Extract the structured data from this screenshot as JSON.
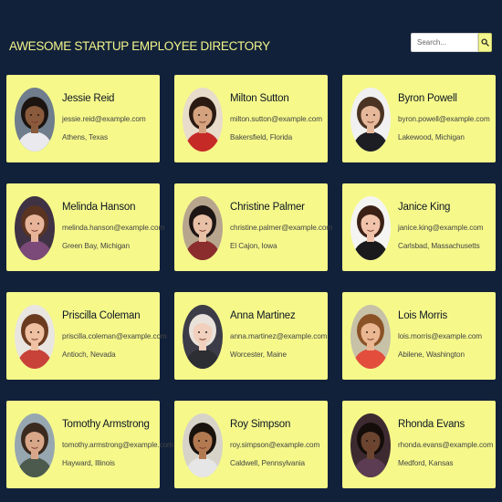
{
  "header": {
    "title": "AWESOME STARTUP EMPLOYEE DIRECTORY",
    "search_placeholder": "Search...",
    "search_icon": "search-icon"
  },
  "colors": {
    "background": "#12213a",
    "card": "#f6f98a",
    "title": "#f2f58a"
  },
  "employees": [
    {
      "name": "Jessie Reid",
      "email": "jessie.reid@example.com",
      "city": "Athens, Texas",
      "skin": "#8a5a3c",
      "hair": "#1b1410",
      "shirt": "#e9e9ee",
      "bg": "#6f7d8c"
    },
    {
      "name": "Milton Sutton",
      "email": "milton.sutton@example.com",
      "city": "Bakersfield, Florida",
      "skin": "#d4a27e",
      "hair": "#2a1a12",
      "shirt": "#c62a26",
      "bg": "#e8dccb"
    },
    {
      "name": "Byron Powell",
      "email": "byron.powell@example.com",
      "city": "Lakewood, Michigan",
      "skin": "#e6b89a",
      "hair": "#4a3322",
      "shirt": "#1d1d24",
      "bg": "#f1f1f1"
    },
    {
      "name": "Melinda Hanson",
      "email": "melinda.hanson@example.com",
      "city": "Green Bay, Michigan",
      "skin": "#e7b49a",
      "hair": "#5a3420",
      "shirt": "#7b4a78",
      "bg": "#3f3244"
    },
    {
      "name": "Christine Palmer",
      "email": "christine.palmer@example.com",
      "city": "El Cajon, Iowa",
      "skin": "#e8c0a6",
      "hair": "#1e1614",
      "shirt": "#8b2d2d",
      "bg": "#b8a58e"
    },
    {
      "name": "Janice King",
      "email": "janice.king@example.com",
      "city": "Carlsbad, Massachusetts",
      "skin": "#f0c3aa",
      "hair": "#3b2016",
      "shirt": "#1a1a1d",
      "bg": "#f4f4f2"
    },
    {
      "name": "Priscilla Coleman",
      "email": "priscilla.coleman@example.com",
      "city": "Antioch, Nevada",
      "skin": "#efc1a2",
      "hair": "#6b3b1f",
      "shirt": "#c8423a",
      "bg": "#e9e5e0"
    },
    {
      "name": "Anna Martinez",
      "email": "anna.martinez@example.com",
      "city": "Worcester, Maine",
      "skin": "#f1d0bd",
      "hair": "#e8e2da",
      "shirt": "#2d2d34",
      "bg": "#3c3c48"
    },
    {
      "name": "Lois Morris",
      "email": "lois.morris@example.com",
      "city": "Abilene, Washington",
      "skin": "#eab792",
      "hair": "#8a5226",
      "shirt": "#e24d3c",
      "bg": "#c7c1a8"
    },
    {
      "name": "Tomothy Armstrong",
      "email": "tomothy.armstrong@example.com",
      "city": "Hayward, Illinois",
      "skin": "#d8a789",
      "hair": "#3b2a1e",
      "shirt": "#4b5a4c",
      "bg": "#97a7b0"
    },
    {
      "name": "Roy Simpson",
      "email": "roy.simpson@example.com",
      "city": "Caldwell, Pennsylvania",
      "skin": "#b37a52",
      "hair": "#1a120c",
      "shirt": "#e6e6e6",
      "bg": "#d7d3c9"
    },
    {
      "name": "Rhonda Evans",
      "email": "rhonda.evans@example.com",
      "city": "Medford, Kansas",
      "skin": "#6b4530",
      "hair": "#140d0a",
      "shirt": "#5b3c52",
      "bg": "#3d2a30"
    }
  ]
}
